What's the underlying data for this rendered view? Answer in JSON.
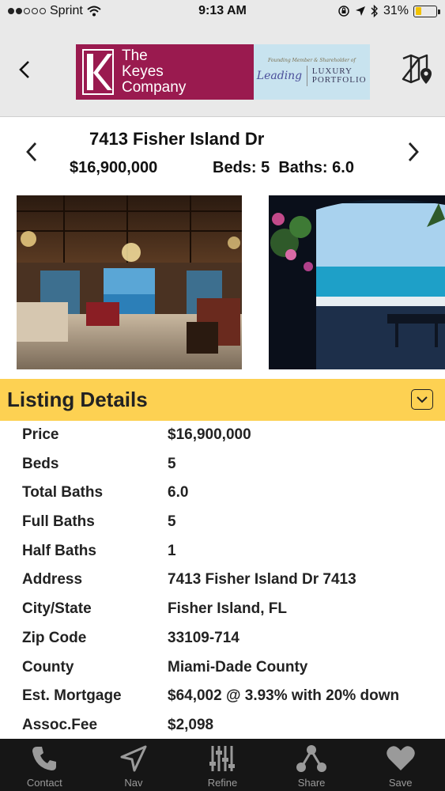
{
  "status_bar": {
    "carrier": "Sprint",
    "time": "9:13 AM",
    "battery_percent": "31%",
    "battery_level": 0.31,
    "signal_bars_filled": 2,
    "signal_bars_total": 5
  },
  "header": {
    "logo": {
      "company_line1": "The",
      "company_line2": "Keyes",
      "company_line3": "Company",
      "tagline": "Founding Member & Shareholder of",
      "partner_1": "Leading",
      "partner_2": "LUXURY PORTFOLIO"
    }
  },
  "listing": {
    "address": "7413 Fisher Island Dr",
    "price": "$16,900,000",
    "beds_baths": "Beds: 5  Baths: 6.0"
  },
  "details_section": {
    "title": "Listing Details",
    "rows": [
      {
        "label": "Price",
        "value": "$16,900,000"
      },
      {
        "label": "Beds",
        "value": "5"
      },
      {
        "label": "Total Baths",
        "value": "6.0"
      },
      {
        "label": "Full Baths",
        "value": "5"
      },
      {
        "label": "Half Baths",
        "value": "1"
      },
      {
        "label": "Address",
        "value": "7413 Fisher Island Dr 7413"
      },
      {
        "label": "City/State",
        "value": "Fisher Island, FL"
      },
      {
        "label": "Zip Code",
        "value": "33109-714"
      },
      {
        "label": "County",
        "value": "Miami-Dade County"
      },
      {
        "label": "Est. Mortgage",
        "value": "$64,002 @ 3.93% with 20% down"
      },
      {
        "label": "Assoc.Fee",
        "value": "$2,098"
      }
    ]
  },
  "tab_bar": {
    "tabs": [
      {
        "label": "Contact",
        "icon": "phone-icon"
      },
      {
        "label": "Nav",
        "icon": "navigation-arrow-icon"
      },
      {
        "label": "Refine",
        "icon": "sliders-icon"
      },
      {
        "label": "Share",
        "icon": "share-icon"
      },
      {
        "label": "Save",
        "icon": "heart-icon"
      }
    ]
  },
  "colors": {
    "brand": "#9a1a4f",
    "section_header": "#fdd152",
    "tab_bar": "#161616",
    "header_bg": "#e9e9e9"
  }
}
